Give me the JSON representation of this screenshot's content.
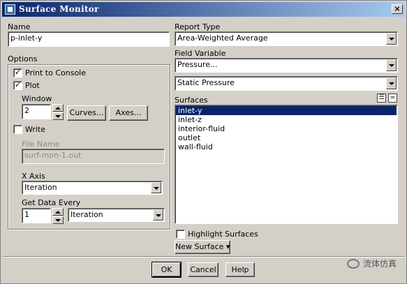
{
  "window": {
    "title": "Surface Monitor",
    "close_glyph": "×"
  },
  "left": {
    "name_label": "Name",
    "name_value": "p-inlet-y",
    "options_label": "Options",
    "print_to_console": {
      "label": "Print to Console",
      "checked": true,
      "mark": "✓"
    },
    "plot": {
      "label": "Plot",
      "checked": true,
      "mark": "✓"
    },
    "window_label": "Window",
    "window_value": "2",
    "curves_button": "Curves...",
    "axes_button": "Axes...",
    "write": {
      "label": "Write",
      "checked": false
    },
    "file_name_label": "File Name",
    "file_name_value": "surf-mon-1.out",
    "x_axis_label": "X Axis",
    "x_axis_value": "Iteration",
    "get_data_every_label": "Get Data Every",
    "get_data_every_value": "1",
    "get_data_unit_value": "Iteration"
  },
  "right": {
    "report_type_label": "Report Type",
    "report_type_value": "Area-Weighted Average",
    "field_variable_label": "Field Variable",
    "field_variable_value": "Pressure...",
    "field_variable_sub_value": "Static Pressure",
    "surfaces_label": "Surfaces",
    "surfaces": [
      {
        "label": "inlet-y",
        "selected": true
      },
      {
        "label": "inlet-z",
        "selected": false
      },
      {
        "label": "interior-fluid",
        "selected": false
      },
      {
        "label": "outlet",
        "selected": false
      },
      {
        "label": "wall-fluid",
        "selected": false
      }
    ],
    "select_all_glyph": "☰",
    "deselect_all_glyph": "=",
    "highlight_surfaces": {
      "label": "Highlight Surfaces",
      "checked": false
    },
    "new_surface_button": "New Surface ▾"
  },
  "footer": {
    "ok": "OK",
    "cancel": "Cancel",
    "help": "Help"
  },
  "watermark": {
    "text": "流体仿真"
  }
}
